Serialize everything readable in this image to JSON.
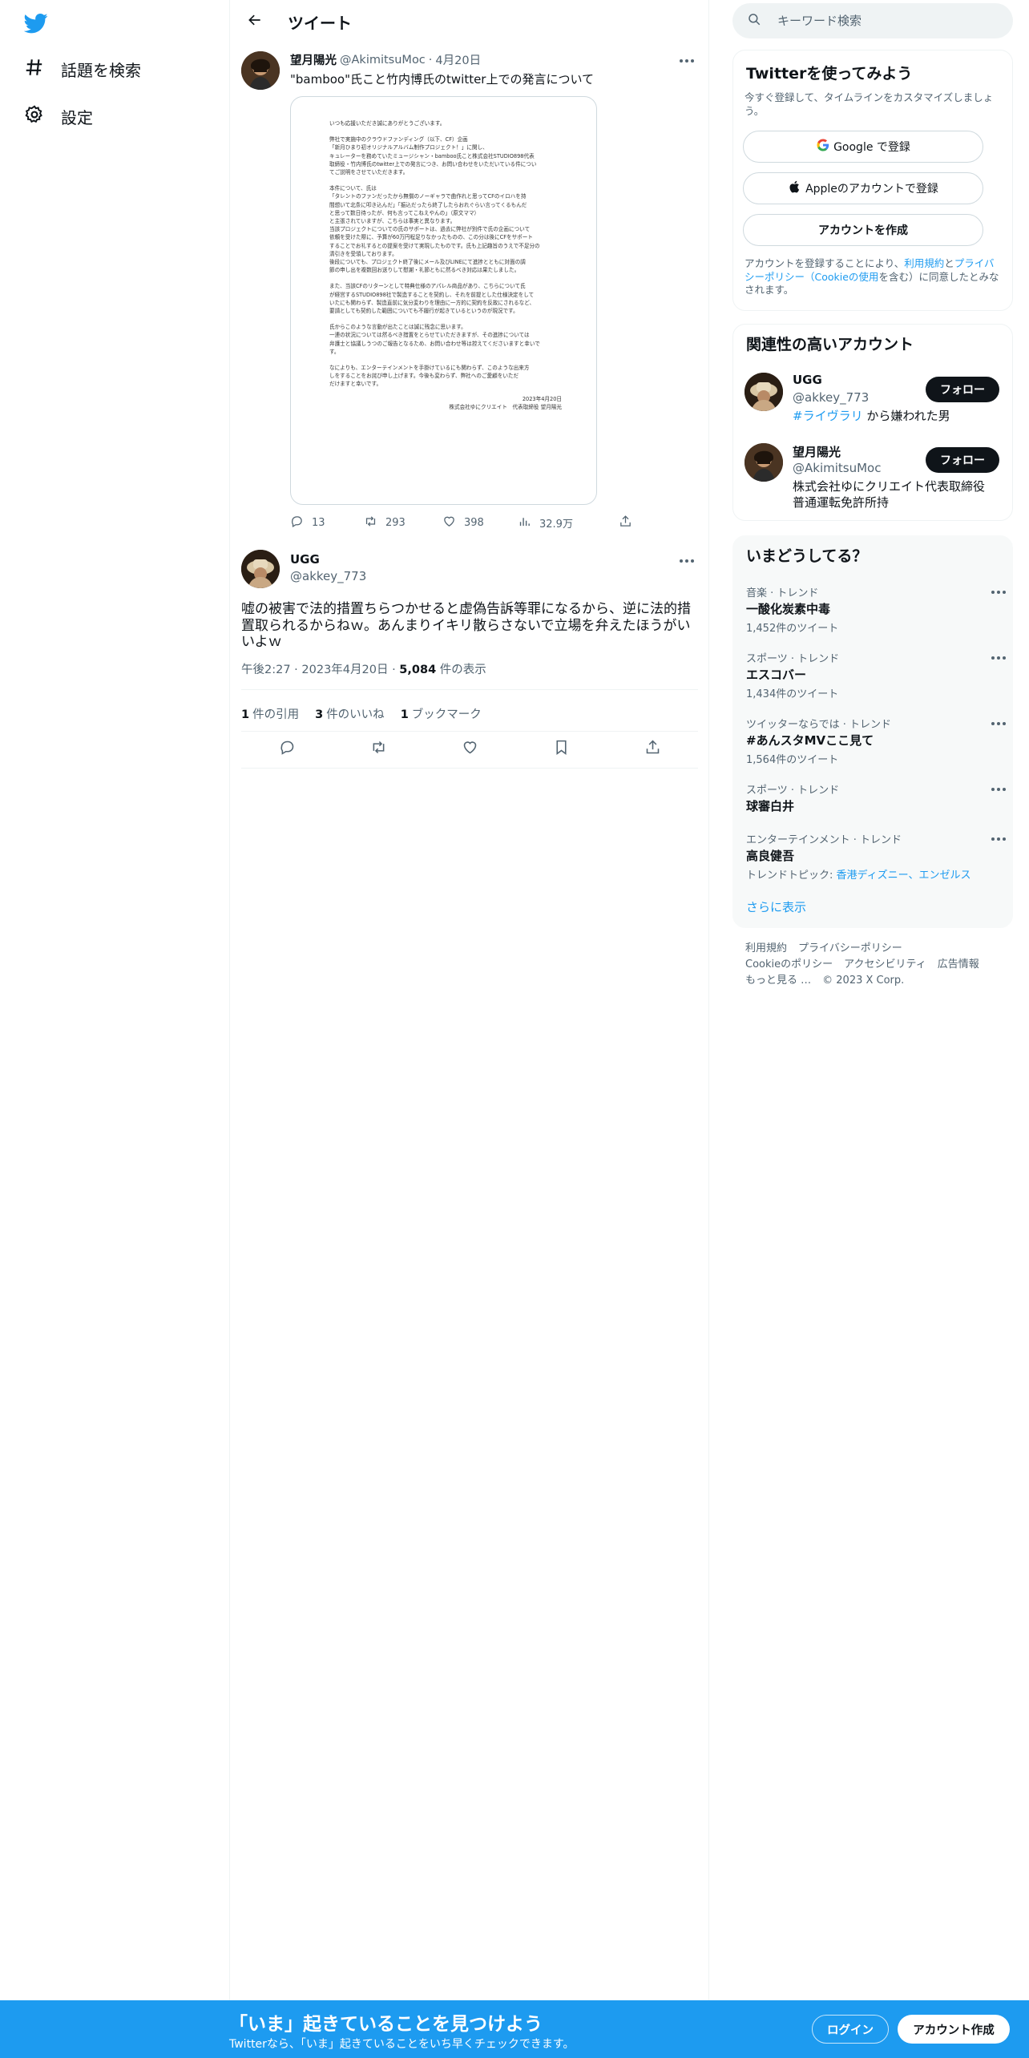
{
  "colors": {
    "brand": "#1d9bf0",
    "text": "#0f1419",
    "secondary": "#536471",
    "border": "#eff3f4"
  },
  "left_nav": {
    "logo_icon": "twitter-bird-icon",
    "items": [
      {
        "label": "話題を検索",
        "icon": "hashtag-icon"
      },
      {
        "label": "設定",
        "icon": "gear-icon"
      }
    ]
  },
  "header": {
    "title": "ツイート",
    "back_icon": "back-arrow-icon"
  },
  "quoted_tweet": {
    "name": "望月陽光",
    "handle": "@AkimitsuMoc",
    "separator": "·",
    "date": "4月20日",
    "text": "\"bamboo\"氏こと竹内博氏のtwitter上での発言について",
    "document_lines": [
      "いつも応援いただき誠にありがとうございます。",
      "",
      "弊社で実施中のクラウドファンディング（以下、CF）企画",
      "「新月ひまり初オリジナルアルバム制作プロジェクト！」に関し、",
      "キュレーターを務めていたミュージシャン・bamboo氏こと株式会社STUDIO898代表",
      "取締役・竹内博氏のtwitter上での発言につき、お問い合わせをいただいている件につい",
      "てご説明をさせていただきます。",
      "",
      "本件について、氏は",
      "「タレントのファンだったから無償のノーギャラで曲作れと思ってCFのイロハを持",
      "間想いて北条に叩き込んだ」「振込だったら終了したらおれぐらい言ってくるもんだ",
      "と思って数日待ったが、何も言ってこねえやんの」（原文ママ）",
      "と主張されていますが、こちらは事実と異なります。",
      "当該プロジェクトについての氏のサポートは、過去に弊社が別件で氏の企画について",
      "依頼を受けた際に、予算が60万円程足りなかったものの、この分は後にCFをサポート",
      "することでお礼するとの提案を受けて実現したものです。氏も上記趣旨のうえで不足分の",
      "清引きを受領しております。",
      "後段についても、プロジェクト終了後にメール及びLINEにて進捗とともに対面の調",
      "節の申し出を複数回お送りして慰謝・礼節ともに然るべき対応は果たしました。",
      "",
      "また、当該CFのリターンとして特典仕様のアパレル商品があり、こちらについて氏",
      "が経営するSTUDIO898社で製造することを契約し、それを前提とした仕様決定をして",
      "いたにも関わらず、製造直前に気分変わりを理由に一方的に契約を反故にされるなど、",
      "要請としても契約した範囲についても不履行が起きているというのが現況です。",
      "",
      "氏からこのような言動が出たことは誠に残念に思います。",
      "一連の状況については然るべき措置をとらせていただきますが、その進捗については",
      "弁護士と協議しうつのご報告となるため、お問い合わせ等は控えてくださいますと幸いで",
      "す。",
      "",
      "なによりも、エンターテインメントを手掛けているにも関わらず、このような出来方",
      "しをすることをお詫び申し上げます。今後も変わらず、弊社へのご愛顧をいただ",
      "だけますと幸いです。"
    ],
    "document_date": "2023年4月20日",
    "document_signature": "株式会社ゆにクリエイト　代表取締役 望月陽光",
    "counts": {
      "replies": "13",
      "retweets": "293",
      "likes": "398",
      "views": "32.9万"
    }
  },
  "main_tweet": {
    "name": "UGG",
    "handle": "@akkey_773",
    "text": "嘘の被害で法的措置ちらつかせると虚偽告訴等罪になるから、逆に法的措置取られるからねｗ。あんまりイキリ散らさないで立場を弁えたほうがいいよｗ",
    "time": "午後2:27",
    "date": "2023年4月20日",
    "meta_sep": "·",
    "views_count": "5,084",
    "views_label": "件の表示",
    "stats": [
      {
        "count": "1",
        "label": "件の引用"
      },
      {
        "count": "3",
        "label": "件のいいね"
      },
      {
        "count": "1",
        "label": "ブックマーク"
      }
    ]
  },
  "search": {
    "placeholder": "キーワード検索"
  },
  "signup": {
    "title": "Twitterを使ってみよう",
    "subtitle": "今すぐ登録して、タイムラインをカスタマイズしましょう。",
    "google_label": "Google で登録",
    "apple_label": "Appleのアカウントで登録",
    "create_label": "アカウントを作成",
    "legal_pre": "アカウントを登録することにより、",
    "legal_terms": "利用規約",
    "legal_and": "と",
    "legal_privacy": "プライバシーポリシー（Cookieの使用",
    "legal_post": "を含む）に同意したとみなされます。"
  },
  "related": {
    "title": "関連性の高いアカウント",
    "accounts": [
      {
        "name": "UGG",
        "handle": "@akkey_773",
        "bio_tag": "#ライヴラリ",
        "bio_text": " から嫌われた男",
        "follow_label": "フォロー"
      },
      {
        "name": "望月陽光",
        "handle": "@AkimitsuMoc",
        "bio_tag": "",
        "bio_text": "株式会社ゆにクリエイト代表取締役 普通運転免許所持",
        "follow_label": "フォロー"
      }
    ]
  },
  "trends": {
    "title": "いまどうしてる？",
    "items": [
      {
        "context": "音楽 · トレンド",
        "name": "一酸化炭素中毒",
        "count": "1,452件のツイート"
      },
      {
        "context": "スポーツ · トレンド",
        "name": "エスコバー",
        "count": "1,434件のツイート"
      },
      {
        "context": "ツイッターならでは · トレンド",
        "name": "#あんスタMVここ見て",
        "count": "1,564件のツイート"
      },
      {
        "context": "スポーツ · トレンド",
        "name": "球審白井",
        "count": ""
      },
      {
        "context": "エンターテインメント · トレンド",
        "name": "高良健吾",
        "count_prefix": "トレンドトピック: ",
        "count_links": "香港ディズニー、エンゼルス"
      }
    ],
    "show_more": "さらに表示"
  },
  "footer": {
    "links": [
      "利用規約",
      "プライバシーポリシー",
      "Cookieのポリシー",
      "アクセシビリティ",
      "広告情報",
      "もっと見る …"
    ],
    "copyright": "© 2023 X Corp."
  },
  "bottom_bar": {
    "title": "「いま」起きていることを見つけよう",
    "subtitle": "Twitterなら、「いま」起きていることをいち早くチェックできます。",
    "login_label": "ログイン",
    "signup_label": "アカウント作成"
  }
}
